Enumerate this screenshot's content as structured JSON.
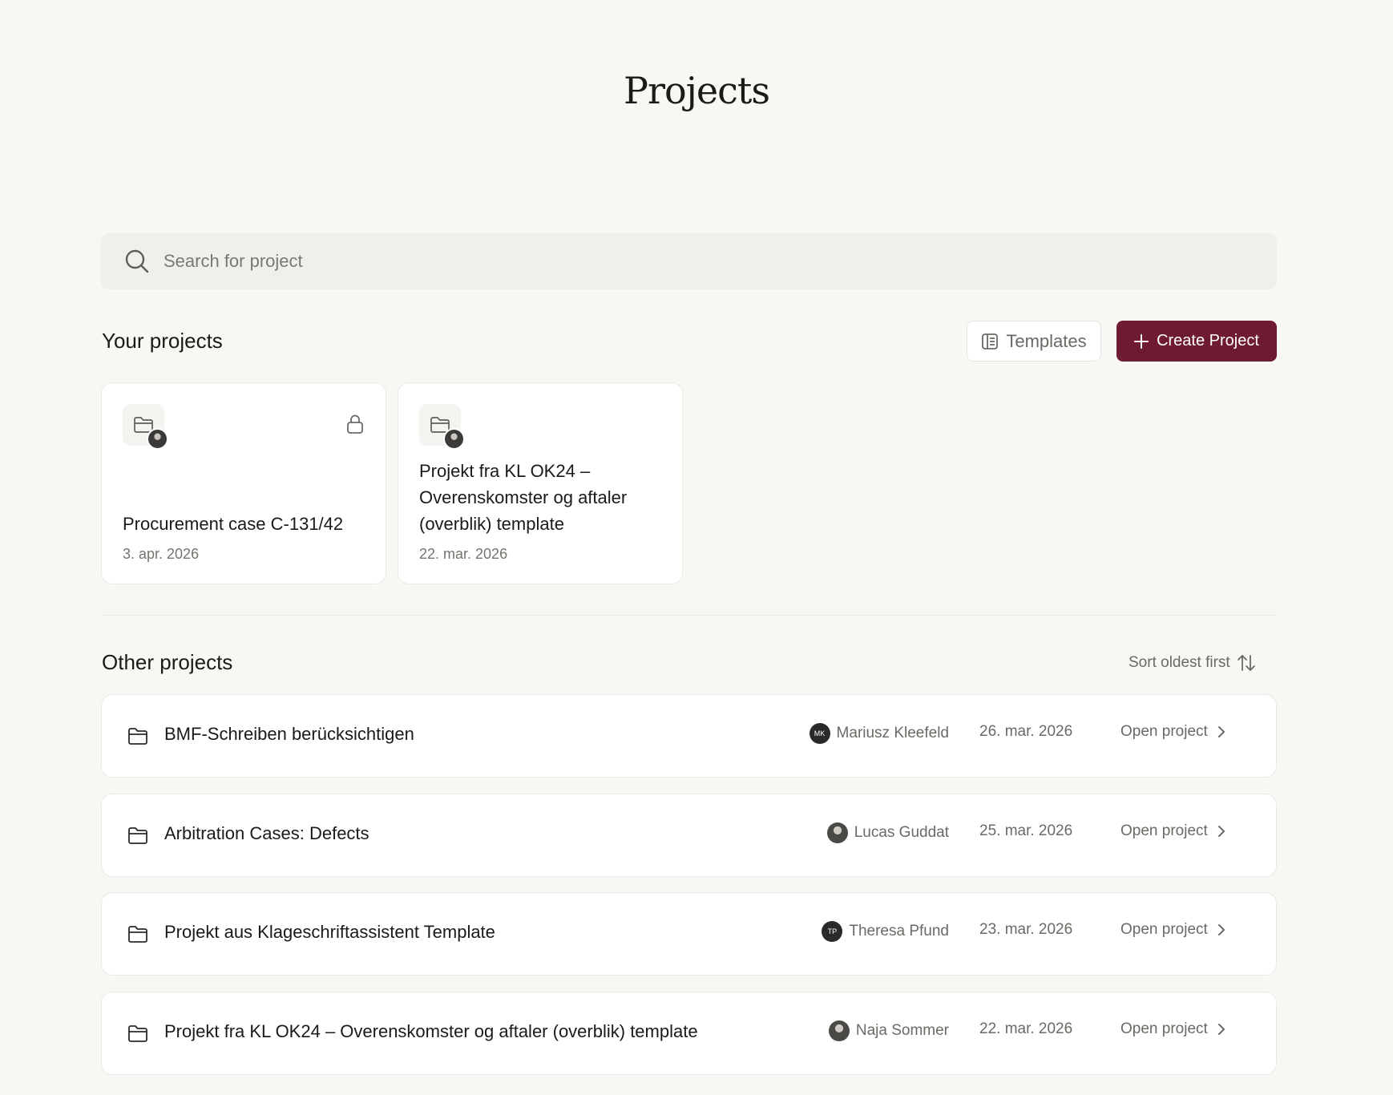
{
  "page": {
    "title": "Projects"
  },
  "search": {
    "placeholder": "Search for project",
    "icon": "search-icon"
  },
  "your_projects": {
    "title": "Your projects",
    "templates_label": "Templates",
    "create_label": "Create Project",
    "cards": [
      {
        "title": "Procurement case C-131/42",
        "date": "3. apr. 2026",
        "locked": true
      },
      {
        "title": "Projekt fra KL OK24 – Overenskomster og aftaler (overblik) template",
        "date": "22. mar. 2026",
        "locked": false
      }
    ]
  },
  "other_projects": {
    "title": "Other projects",
    "sort_label": "Sort oldest first",
    "open_label": "Open project",
    "rows": [
      {
        "name": "BMF-Schreiben berücksichtigen",
        "owner": "Mariusz Kleefeld",
        "initials": "MK",
        "date": "26. mar. 2026"
      },
      {
        "name": "Arbitration Cases: Defects",
        "owner": "Lucas Guddat",
        "initials": "",
        "date": "25. mar. 2026"
      },
      {
        "name": "Projekt aus Klageschriftassistent Template",
        "owner": "Theresa Pfund",
        "initials": "TP",
        "date": "23. mar. 2026"
      },
      {
        "name": "Projekt fra KL OK24 – Overenskomster og aftaler (overblik) template",
        "owner": "Naja Sommer",
        "initials": "",
        "date": "22. mar. 2026"
      }
    ]
  },
  "colors": {
    "accent": "#6e1a30",
    "background": "#f8f7f4",
    "muted_text": "#6b6964"
  }
}
